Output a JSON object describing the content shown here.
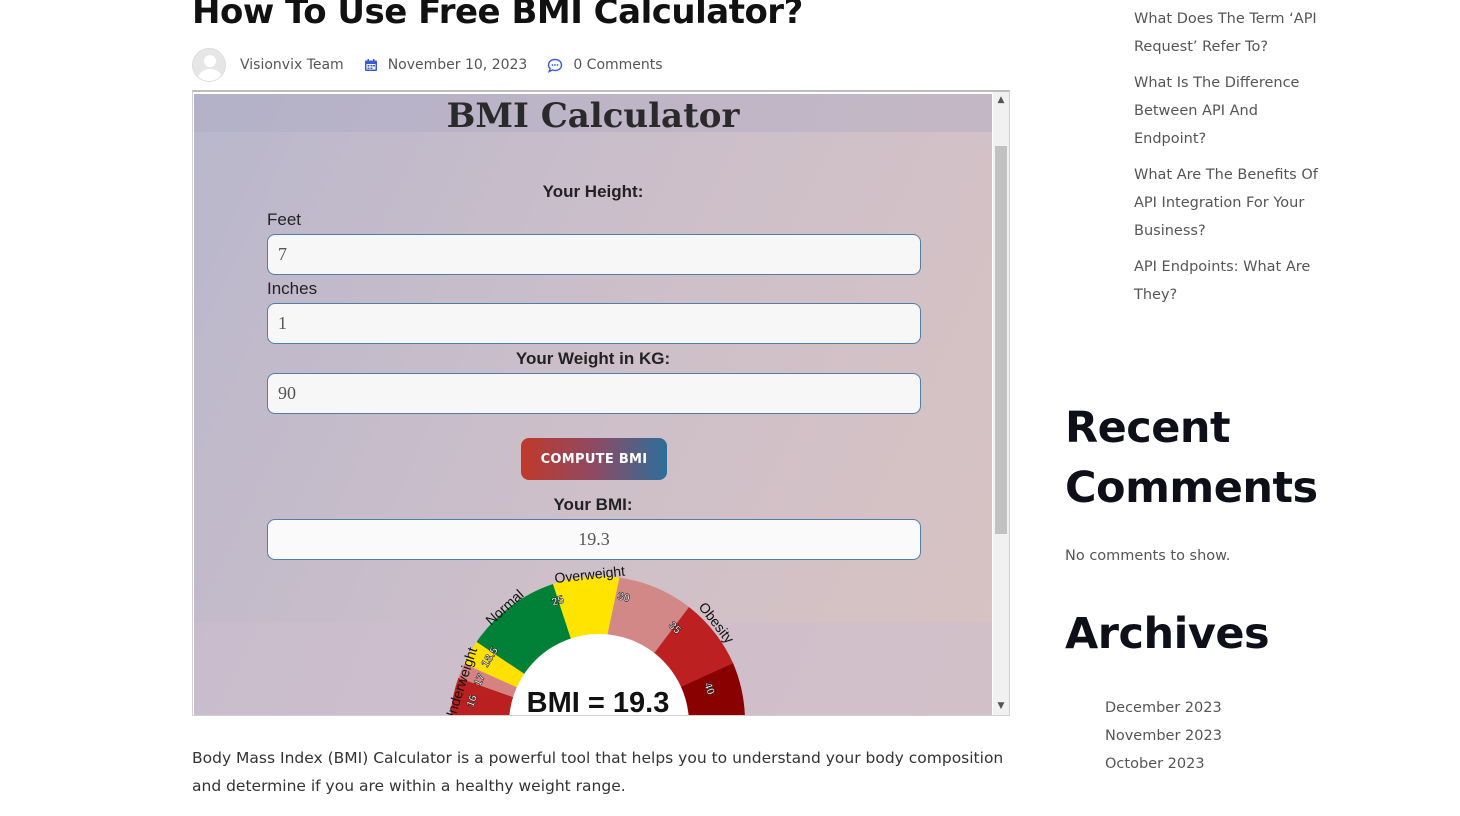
{
  "post": {
    "title": "How To Use Free BMI Calculator?",
    "author": "Visionvix Team",
    "date": "November 10, 2023",
    "comments": "0 Comments"
  },
  "calculator": {
    "title": "BMI Calculator",
    "height_label": "Your Height:",
    "feet_label": "Feet",
    "feet_value": "7",
    "inches_label": "Inches",
    "inches_value": "1",
    "weight_label": "Your Weight in KG:",
    "weight_value": "90",
    "compute_label": "COMPUTE BMI",
    "result_label": "Your BMI:",
    "result_value": "19.3",
    "gauge": {
      "readout": "BMI = 19.3",
      "categories": [
        "Underweight",
        "Normal",
        "Overweight",
        "Obesity"
      ],
      "ticks": [
        "16",
        "17",
        "18.5",
        "25",
        "30",
        "35",
        "40"
      ],
      "colors": {
        "severe_under": "#bb2020",
        "under": "#d48282",
        "mild_under": "#ffe000",
        "normal": "#008137",
        "overweight": "#ffe400",
        "pre_obese": "#d38888",
        "obese1": "#bc2020",
        "obese3": "#8a0101"
      }
    }
  },
  "body_text": "Body Mass Index (BMI) Calculator is a powerful tool that helps you to understand your body composition and determine if you are within a healthy weight range.",
  "sidebar": {
    "related_posts": [
      "What Does The Term ‘API Request’ Refer To?",
      "What Is The Difference Between API And Endpoint?",
      "What Are The Benefits Of API Integration For Your Business?",
      "API Endpoints: What Are They?"
    ],
    "recent_comments_title": "Recent Comments",
    "no_comments": "No comments to show.",
    "archives_title": "Archives",
    "archives": [
      "December 2023",
      "November 2023",
      "October 2023"
    ]
  },
  "colors": {
    "accent_blue": "#3b5ccf",
    "input_border": "#4f7fa4",
    "button_gradient_start": "#c0392b",
    "button_gradient_end": "#2d6e9a"
  },
  "icons": [
    "user-avatar-icon",
    "calendar-icon",
    "comment-icon",
    "scroll-up-arrow-icon",
    "scroll-down-arrow-icon"
  ]
}
